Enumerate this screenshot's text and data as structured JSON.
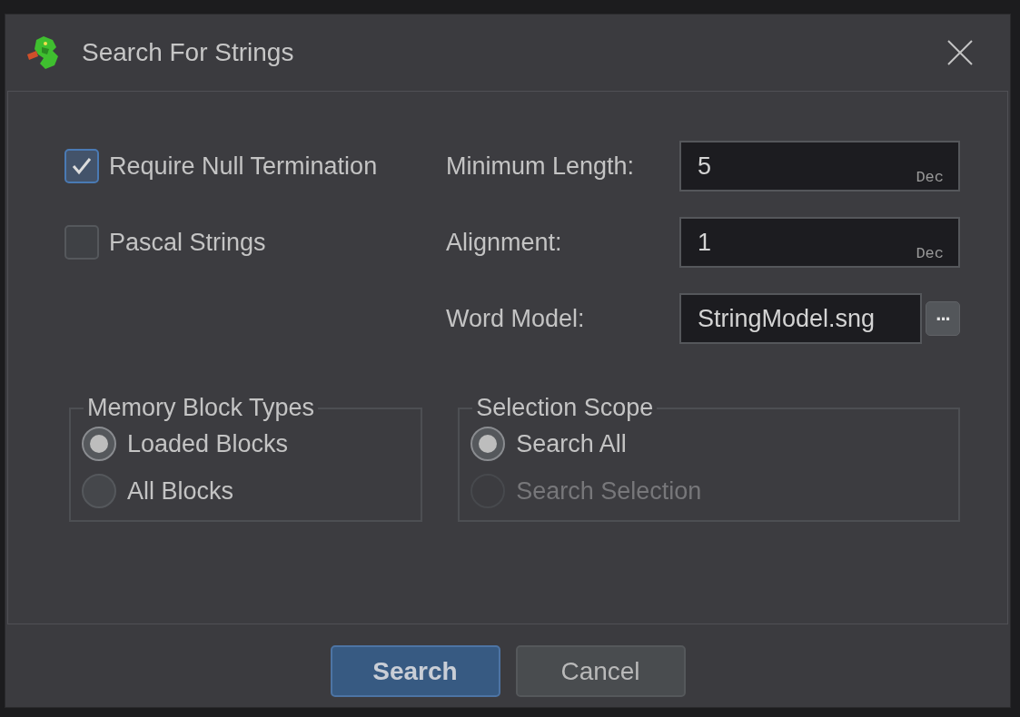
{
  "window": {
    "title": "Search For Strings"
  },
  "options": [
    {
      "label": "Require Null Termination",
      "checked": true
    },
    {
      "label": "Pascal Strings",
      "checked": false
    }
  ],
  "fields": [
    {
      "kind": "number",
      "label": "Minimum Length:",
      "value": "5",
      "suffix": "Dec"
    },
    {
      "kind": "number",
      "label": "Alignment:",
      "value": "1",
      "suffix": "Dec"
    },
    {
      "kind": "file",
      "label": "Word Model:",
      "value": "StringModel.sng",
      "button": "..."
    }
  ],
  "groups": [
    {
      "title": "Memory Block Types",
      "options": [
        {
          "label": "Loaded Blocks",
          "selected": true,
          "disabled": false
        },
        {
          "label": "All Blocks",
          "selected": false,
          "disabled": false
        }
      ]
    },
    {
      "title": "Selection Scope",
      "options": [
        {
          "label": "Search All",
          "selected": true,
          "disabled": false
        },
        {
          "label": "Search Selection",
          "selected": false,
          "disabled": true
        }
      ]
    }
  ],
  "buttons": [
    {
      "label": "Search",
      "kind": "primary"
    },
    {
      "label": "Cancel",
      "kind": "secondary"
    }
  ]
}
